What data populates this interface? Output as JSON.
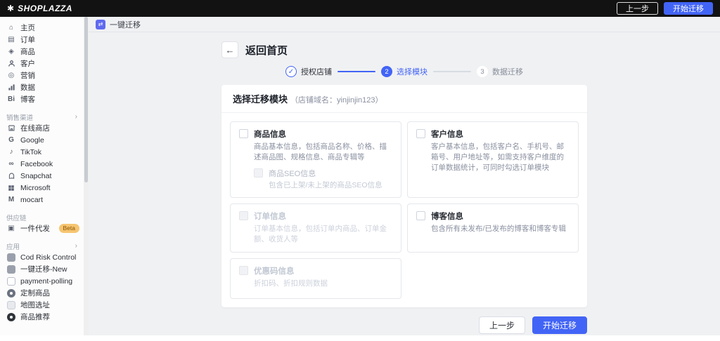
{
  "topbar": {
    "logo_text": "SHOPLAZZA",
    "prev_label": "上一步",
    "start_label": "开始迁移"
  },
  "breadcrumb": {
    "label": "一键迁移"
  },
  "page": {
    "back_label": "返回首页"
  },
  "steps": [
    {
      "label": "授权店铺",
      "state": "done"
    },
    {
      "num": "2",
      "label": "选择模块",
      "state": "active"
    },
    {
      "num": "3",
      "label": "数据迁移",
      "state": "pending"
    }
  ],
  "card": {
    "title": "选择迁移模块",
    "subtitle": "（店铺域名：yinjinjin123）",
    "modules": [
      {
        "label": "商品信息",
        "desc": "商品基本信息，包括商品名称、价格、描述商品图、规格信息、商品专辑等",
        "enabled": true,
        "checked": false,
        "sub": {
          "label": "商品SEO信息",
          "desc": "包含已上架/未上架的商品SEO信息",
          "enabled": false,
          "checked": false
        }
      },
      {
        "label": "客户信息",
        "desc": "客户基本信息，包括客户名、手机号、邮箱号、用户地址等，如需支持客户维度的订单数据统计，可同时勾选订单模块",
        "enabled": true,
        "checked": false
      },
      {
        "label": "订单信息",
        "desc": "订单基本信息，包括订单内商品、订单金额、收货人等",
        "enabled": false,
        "checked": false
      },
      {
        "label": "博客信息",
        "desc": "包含所有未发布/已发布的博客和博客专辑",
        "enabled": true,
        "checked": false
      },
      {
        "label": "优惠码信息",
        "desc": "折扣码、折扣规则数据",
        "enabled": false,
        "checked": false
      }
    ]
  },
  "footer": {
    "prev_label": "上一步",
    "start_label": "开始迁移"
  },
  "sidebar": {
    "rows": [
      {
        "label": "主页"
      },
      {
        "label": "订单"
      },
      {
        "label": "商品"
      },
      {
        "label": "客户"
      },
      {
        "label": "营销"
      },
      {
        "label": "数据"
      },
      {
        "label": "博客"
      },
      {
        "label": "销售渠道"
      },
      {
        "label": "在线商店"
      },
      {
        "label": "Google"
      },
      {
        "label": "TikTok"
      },
      {
        "label": "Facebook"
      },
      {
        "label": "Snapchat"
      },
      {
        "label": "Microsoft"
      },
      {
        "label": "mocart"
      },
      {
        "label": "供应链"
      },
      {
        "label": "一件代发",
        "badge": "Beta"
      },
      {
        "label": "应用"
      },
      {
        "label": "Cod Risk Control"
      },
      {
        "label": "一键迁移-New"
      },
      {
        "label": "payment-polling"
      },
      {
        "label": "定制商品"
      },
      {
        "label": "地图选址"
      },
      {
        "label": "商品推荐"
      }
    ]
  },
  "icons": {
    "logo_mark": "✱",
    "back_arrow": "←",
    "check": "✓",
    "chevron": "›",
    "home": "⌂",
    "orders": "▤",
    "products": "◈",
    "marketing": "◎",
    "blog": "Bi",
    "google": "G",
    "tiktok": "♪",
    "facebook": "∞",
    "mocart": "M",
    "dropship": "▣",
    "migration_app": "⇄"
  },
  "colors": {
    "accent_blue": "#4264f6",
    "topbar_bg": "#121212",
    "sidebar_bg": "#fcfcfc",
    "page_bg": "#f0f1f3",
    "beta_badge_bg": "#f6c571",
    "disabled_text": "#c3c9d4",
    "crumb_icon_bg": "#5f6af0"
  }
}
